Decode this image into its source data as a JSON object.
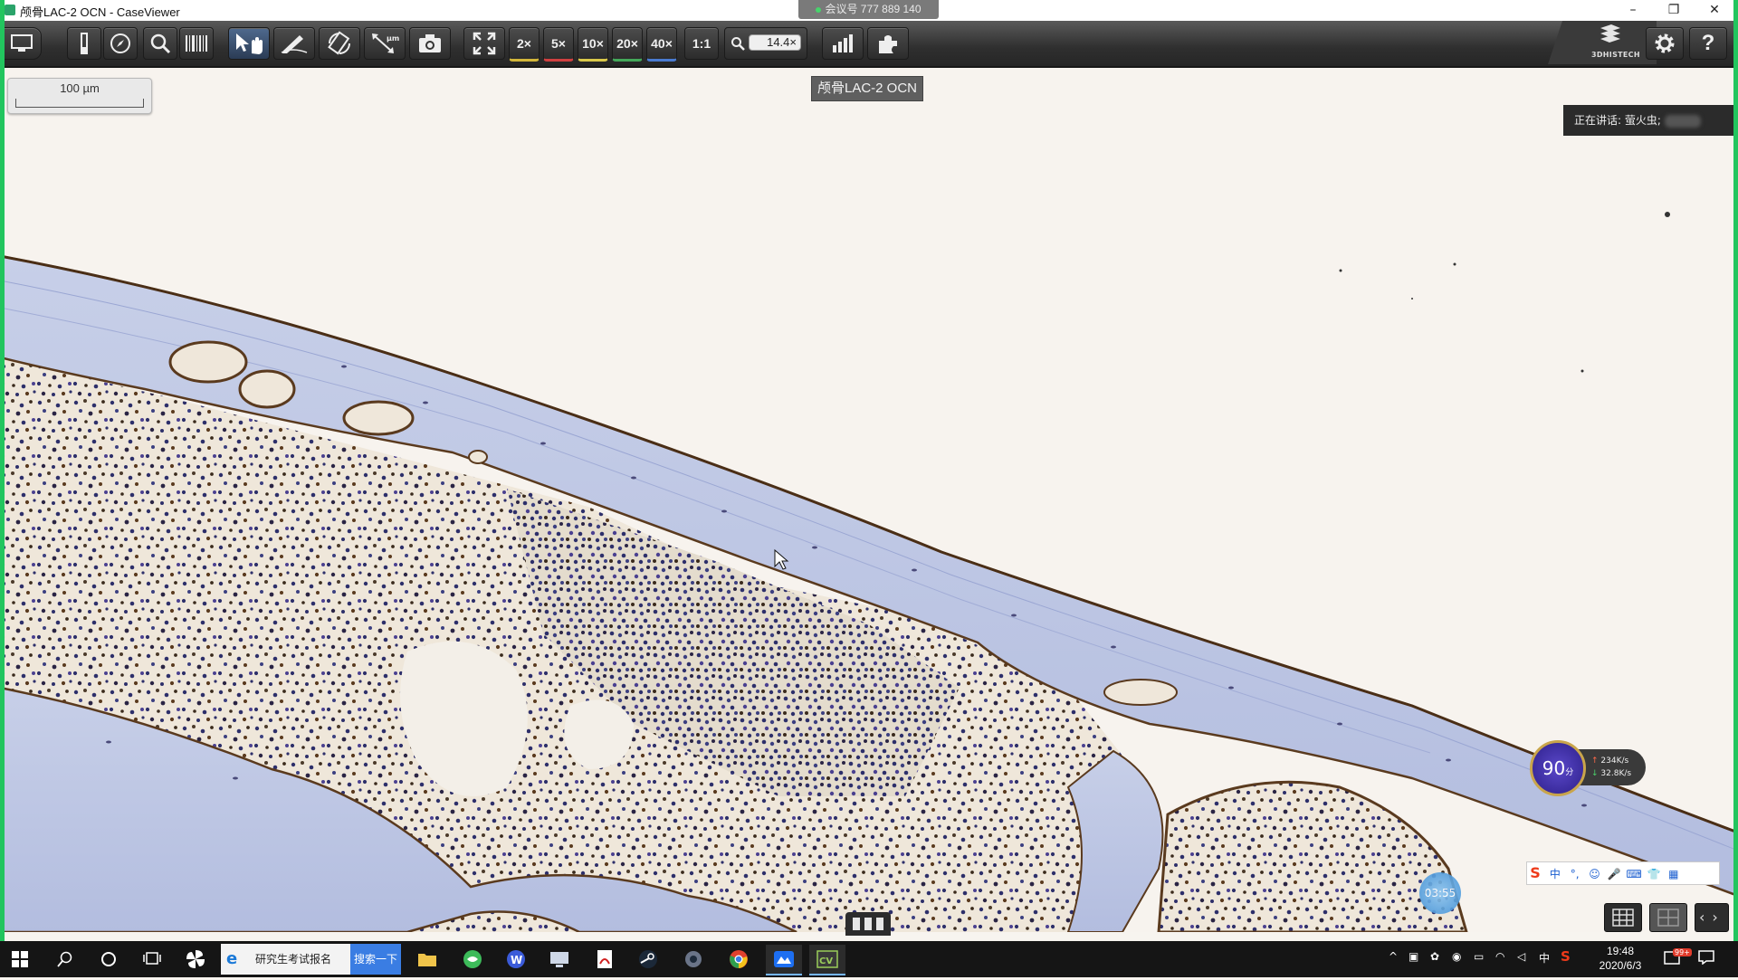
{
  "window": {
    "title": "颅骨LAC-2 OCN - CaseViewer",
    "meeting_id": "会议号 777 889 140",
    "minimize": "–",
    "restore": "❐",
    "close": "✕"
  },
  "toolbar": {
    "mag_2x": "2×",
    "mag_5x": "5×",
    "mag_10x": "10×",
    "mag_20x": "20×",
    "mag_40x": "40×",
    "one_to_one": "1:1",
    "zoom_value": "14.4×",
    "brand": "3DHISTECH",
    "mag_colors": {
      "m2": "#d2b63a",
      "m5": "#d04040",
      "m10": "#d9c84a",
      "m20": "#44a85a",
      "m40": "#4a7bd1"
    },
    "help": "?"
  },
  "viewer": {
    "scalebar_label": "100 µm",
    "slide_name": "颅骨LAC-2 OCN",
    "speaking_label": "正在讲话: 萤火虫;",
    "network_score": "90",
    "network_score_unit": "分",
    "upload_speed": "234K/s",
    "download_speed": "32.8K/s",
    "timer": "03:55",
    "ime_items": [
      "中",
      "°,",
      "☺",
      "🎤",
      "⌨",
      "👕",
      "▦"
    ]
  },
  "taskbar": {
    "search_text": "研究生考试报名",
    "search_button": "搜索一下",
    "ime_mode": "中",
    "time": "19:48",
    "date": "2020/6/3",
    "notification_badge": "99+"
  },
  "colors": {
    "accent": "#22c55e",
    "toolbar_bg": "#2f2f2f",
    "bone": "#b9c3e0",
    "stain_brown": "#5a3a1e",
    "cell_blue": "#2d2f6a"
  }
}
